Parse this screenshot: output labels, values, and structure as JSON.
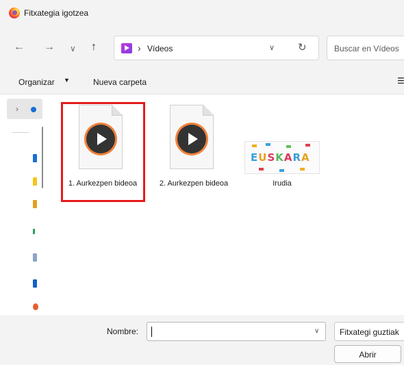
{
  "window": {
    "title": "Fitxategia igotzea"
  },
  "nav": {
    "back_icon": "arrow-left-icon",
    "forward_icon": "arrow-right-icon",
    "recent_icon": "chevron-down-icon",
    "up_icon": "arrow-up-icon",
    "back_glyph": "←",
    "forward_glyph": "→",
    "recent_glyph": "∨",
    "up_glyph": "↑",
    "breadcrumb_sep": "›",
    "current_folder": "Vídeos",
    "dropdown_glyph": "∨",
    "refresh_glyph": "↻",
    "search_placeholder": "Buscar en Vídeos"
  },
  "toolbar": {
    "organize_label": "Organizar",
    "organize_caret": "▼",
    "new_folder_label": "Nueva carpeta",
    "more_label": "☰"
  },
  "sidebar": {
    "expand_glyph": "›"
  },
  "files": [
    {
      "label": "1. Aurkezpen bideoa",
      "type": "video",
      "selected": true
    },
    {
      "label": "2. Aurkezpen bideoa",
      "type": "video",
      "selected": false
    },
    {
      "label": "Irudia",
      "type": "image",
      "thumbnail_text": "EUSKARA",
      "selected": false
    }
  ],
  "footer": {
    "filename_label": "Nombre:",
    "filename_value": "",
    "filename_chevron": "∨",
    "filter_value": "Fitxategi guztiak",
    "open_button": "Abrir"
  },
  "colors": {
    "highlight": "#e51b1b",
    "accent": "#1b6fd6",
    "video_ring": "#f0823c"
  }
}
